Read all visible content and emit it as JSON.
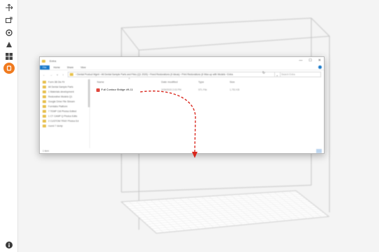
{
  "toolbar": {
    "tools": [
      {
        "name": "move-tool",
        "icon": "move-icon"
      },
      {
        "name": "scale-tool",
        "icon": "scale-icon"
      },
      {
        "name": "rotate-tool",
        "icon": "rotate-icon"
      },
      {
        "name": "mirror-tool",
        "icon": "mirror-icon"
      },
      {
        "name": "per-model-settings-tool",
        "icon": "grid-settings-icon"
      },
      {
        "name": "support-blocker-tool",
        "icon": "support-blocker-icon",
        "active": true,
        "color": "#f07a1e"
      }
    ],
    "bottom_icon": "info-icon"
  },
  "explorer": {
    "title": "Extra",
    "ribbon_tabs": [
      "File",
      "Home",
      "Share",
      "View"
    ],
    "window_controls": [
      "—",
      "☐",
      "✕"
    ],
    "nav_buttons": [
      "←",
      "→",
      "˅",
      "↑"
    ],
    "address": "›  Dental Product Mgmt  ›  All Dental Sample Parts and Files (Q1 2020)  ›  Fixed Restorations (6 Ideas)  ›  Print Restorations (6 Wax-up with Models  ›  Extra",
    "refresh": "↻",
    "search_placeholder": "Search Extra",
    "nav_items": [
      "Form 3B Dis Fil",
      "All Dental Sample Parts",
      "1 Materials development",
      "Restorative Models Q1",
      "Google Drive File Stream",
      "Formlabs Platform",
      "7 TEMP Cdt Photos Edited",
      "1 CT CAMP Q Photos Edits",
      "2 CUSTOM TRAY Photos Ed",
      "round 7 dump"
    ],
    "columns": [
      "Name",
      "Date modified",
      "Type",
      "Size"
    ],
    "file": {
      "name": "Full Contour Bridge #9-11",
      "date": "3/26/2020 2:03 PM",
      "type": "STL File",
      "size": "1,751 KB"
    },
    "status": "1 item"
  },
  "colors": {
    "accent": "#f07a1e",
    "arrow": "#d9261c",
    "ribbon_file": "#1979ca"
  }
}
